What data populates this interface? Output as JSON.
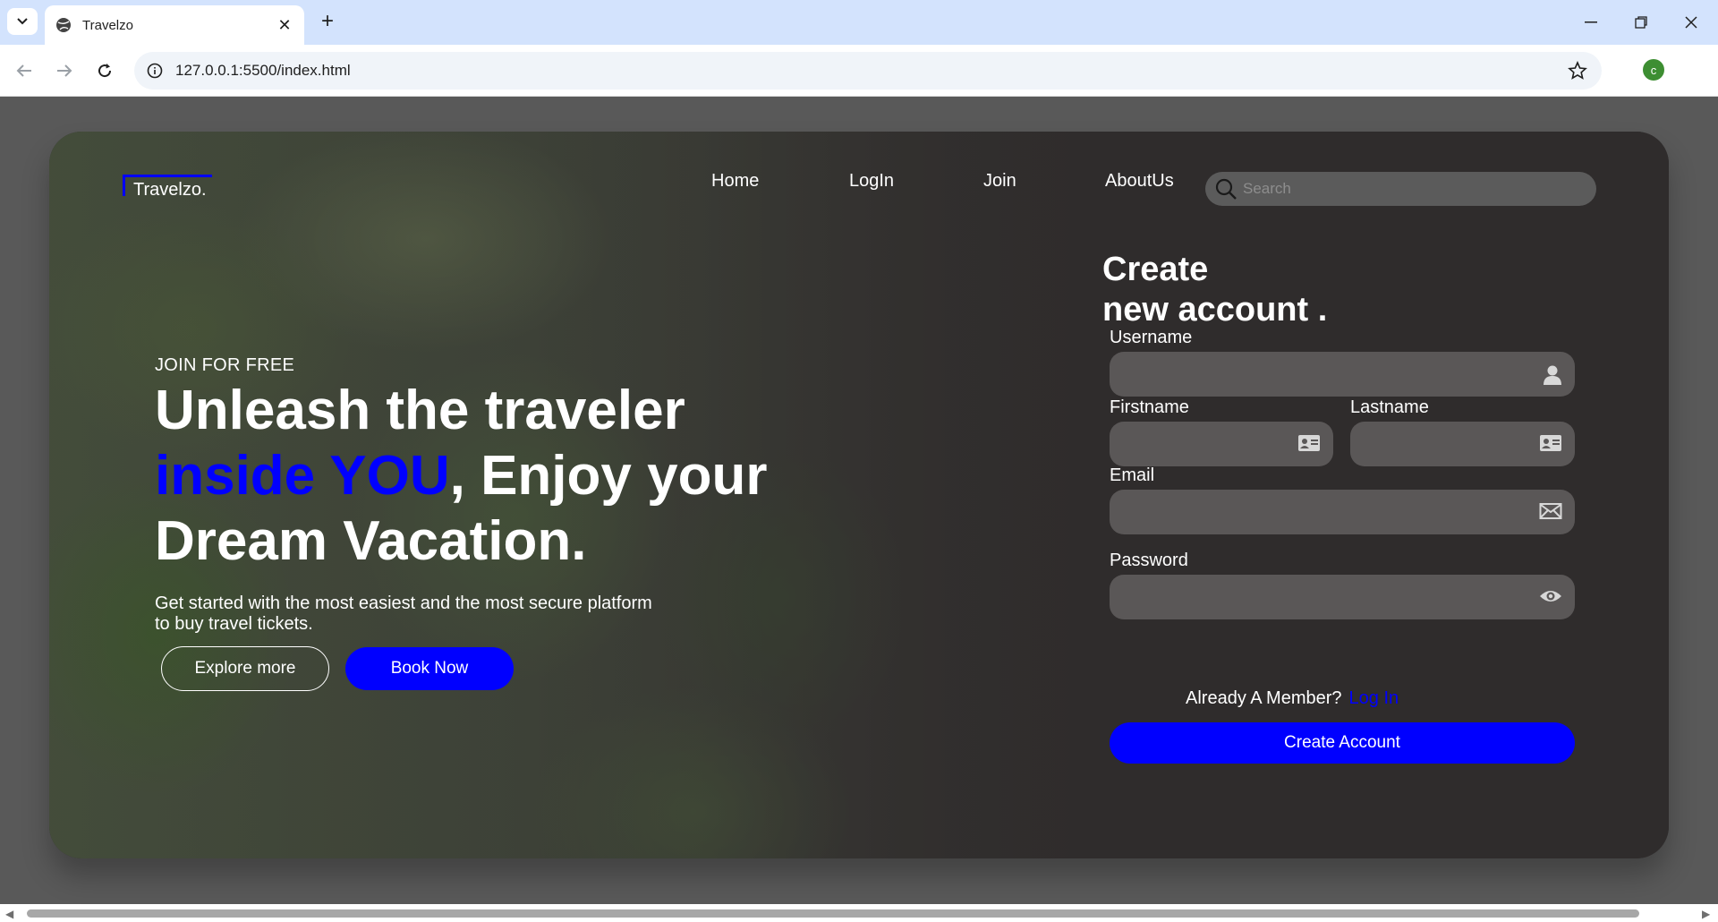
{
  "browser": {
    "tab_title": "Travelzo",
    "url": "127.0.0.1:5500/index.html",
    "profile_initial": "c",
    "new_tab": "+"
  },
  "logo": {
    "text": "Travelzo."
  },
  "nav": {
    "items": [
      "Home",
      "LogIn",
      "Join",
      "AboutUs"
    ],
    "search_placeholder": "Search"
  },
  "hero": {
    "kicker": "JOIN FOR FREE",
    "headline_line1": "Unleash the traveler",
    "headline_accent": "inside YOU",
    "headline_line2_rest": ", Enjoy your",
    "headline_line3": "Dream Vacation.",
    "subtitle": "Get started with the most easiest and the most secure platform to buy travel tickets.",
    "explore_label": "Explore more",
    "book_label": "Book Now"
  },
  "form": {
    "title_line1": "Create",
    "title_line2": "new account .",
    "username_label": "Username",
    "firstname_label": "Firstname",
    "lastname_label": "Lastname",
    "email_label": "Email",
    "password_label": "Password",
    "member_text": "Already A Member?",
    "login_link": "Log In",
    "submit_label": "Create Account"
  },
  "colors": {
    "accent": "#0000ff",
    "card_bg": "#2f2c2c",
    "field_bg": "#5a5757",
    "page_bg": "#595959"
  }
}
